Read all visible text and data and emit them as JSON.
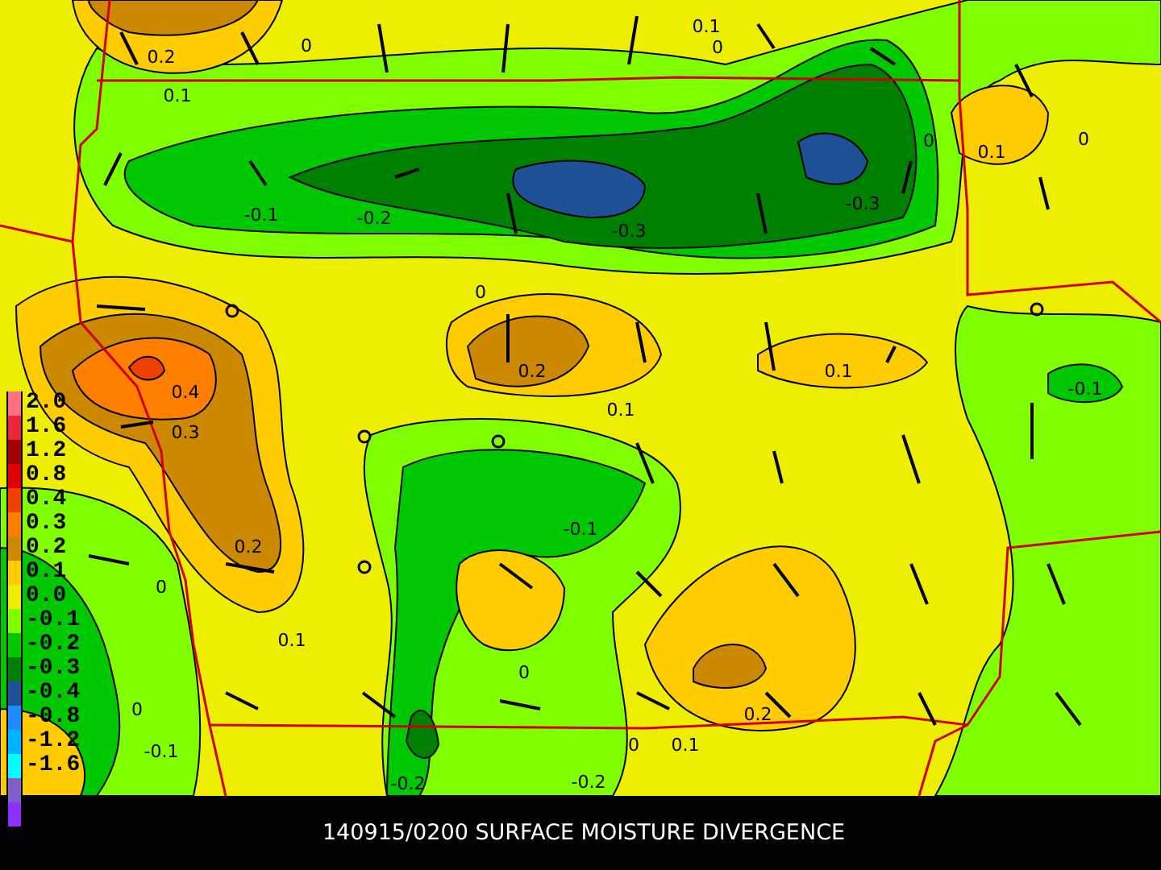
{
  "map": {
    "contour_labels": [
      "0.1",
      "0.2",
      "0",
      "0.1",
      "0",
      "0",
      "0.1",
      "0",
      "-0.1",
      "-0.2",
      "-0.3",
      "-0.3",
      "0",
      "0.4",
      "0.2",
      "0.1",
      "0.1",
      "-0.1",
      "0.3",
      "0.2",
      "-0.1",
      "0",
      "0.1",
      "0",
      "0",
      "0.2",
      "-0.1",
      "0",
      "0.1",
      "-0.2",
      "-0.2"
    ]
  },
  "legend": {
    "items": [
      {
        "label": "2.0",
        "color": "#ff7080"
      },
      {
        "label": "1.6",
        "color": "#e82838"
      },
      {
        "label": "1.2",
        "color": "#a00000"
      },
      {
        "label": "0.8",
        "color": "#e00000"
      },
      {
        "label": "0.4",
        "color": "#f04000"
      },
      {
        "label": "0.3",
        "color": "#ff8000"
      },
      {
        "label": "0.2",
        "color": "#cc8800"
      },
      {
        "label": "0.1",
        "color": "#ffcc00"
      },
      {
        "label": "0.0",
        "color": "#eeee00"
      },
      {
        "label": "-0.1",
        "color": "#80ff00"
      },
      {
        "label": "-0.2",
        "color": "#00c800"
      },
      {
        "label": "-0.3",
        "color": "#008000"
      },
      {
        "label": "-0.4",
        "color": "#1e5096"
      },
      {
        "label": "-0.8",
        "color": "#1e8cff"
      },
      {
        "label": "-1.2",
        "color": "#00b4ff"
      },
      {
        "label": "-1.6",
        "color": "#00ffff"
      },
      {
        "color": "#8060c8"
      },
      {
        "color": "#9030ff"
      }
    ]
  },
  "title": "140915/0200 SURFACE MOISTURE DIVERGENCE"
}
